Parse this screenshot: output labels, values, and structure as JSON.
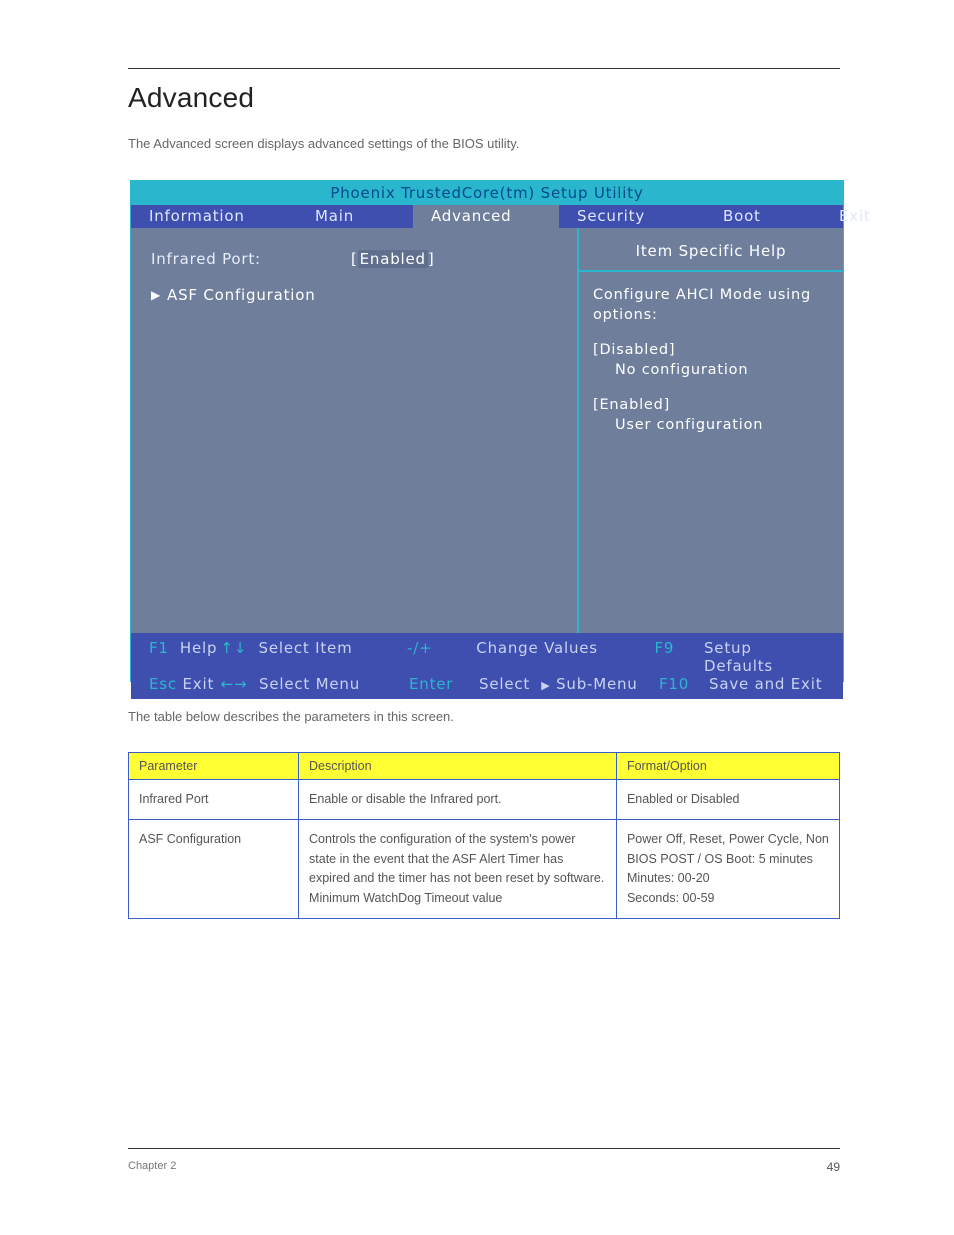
{
  "page_heading": "Advanced",
  "intro_text": "The Advanced screen displays advanced settings of the BIOS utility.",
  "bios": {
    "title": "Phoenix TrustedCore(tm) Setup Utility",
    "tabs": [
      "Information",
      "Main",
      "Advanced",
      "Security",
      "Boot",
      "Exit"
    ],
    "active_tab": "Advanced",
    "items": {
      "infrared": {
        "label": "Infrared Port:",
        "value": "Enabled"
      },
      "asf": {
        "label": "ASF Configuration"
      }
    },
    "help": {
      "title": "Item Specific Help",
      "line1": "Configure AHCI Mode using options:",
      "disabled_label": "[Disabled]",
      "disabled_desc": "No configuration",
      "enabled_label": "[Enabled]",
      "enabled_desc": "User configuration"
    },
    "footer": {
      "f1": "F1",
      "help": "Help",
      "updown": "↑↓",
      "select_item": "Select Item",
      "pm": "-/+",
      "change_values": "Change Values",
      "f9": "F9",
      "setup_defaults": "Setup Defaults",
      "esc": "Esc",
      "exit": "Exit",
      "lr": "←→",
      "select_menu": "Select Menu",
      "enter": "Enter",
      "select_sub": "Select",
      "submenu": "Sub-Menu",
      "f10": "F10",
      "save_exit": "Save and Exit"
    }
  },
  "intro2": "The table below describes the parameters in this screen.",
  "table": {
    "headers": {
      "param": "Parameter",
      "desc": "Description",
      "fmt": "Format/Option"
    },
    "rows": [
      {
        "param": "Infrared Port",
        "desc": "Enable or disable the Infrared port.",
        "fmt": "Enabled or Disabled"
      },
      {
        "param": "ASF Configuration",
        "desc": "Controls the configuration of the system's power state in the event that the ASF Alert Timer has expired and the timer has not been reset by software.\nMinimum WatchDog Timeout value",
        "fmt": "Power Off, Reset, Power Cycle, Non\nBIOS POST / OS Boot: 5 minutes\nMinutes: 00-20\nSeconds: 00-59"
      }
    ]
  },
  "footer_left": "Chapter 2",
  "footer_right": "49"
}
